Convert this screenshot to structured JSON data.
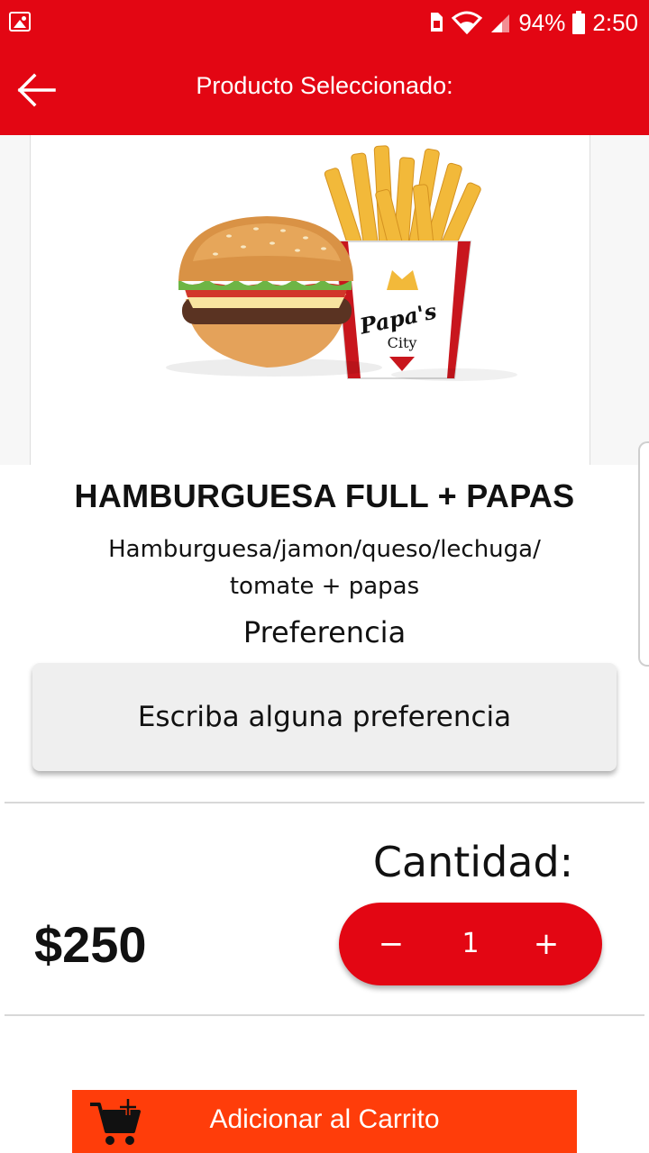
{
  "status_bar": {
    "battery": "94%",
    "time": "2:50"
  },
  "app_bar": {
    "title": "Producto Seleccionado:"
  },
  "product": {
    "image_brand_line1": "Papa's",
    "image_brand_line2": "City",
    "name": "HAMBURGUESA FULL + PAPAS",
    "description": "Hamburguesa/jamon/queso/lechuga/ tomate + papas",
    "price": "$250"
  },
  "preference": {
    "label": "Preferencia",
    "placeholder": "Escriba alguna preferencia",
    "value": ""
  },
  "quantity": {
    "label": "Cantidad:",
    "minus": "−",
    "value": "1",
    "plus": "+"
  },
  "add_to_cart": {
    "label": "Adicionar al Carrito"
  },
  "colors": {
    "primary_red": "#e30613",
    "button_orange": "#ff3d0a"
  }
}
